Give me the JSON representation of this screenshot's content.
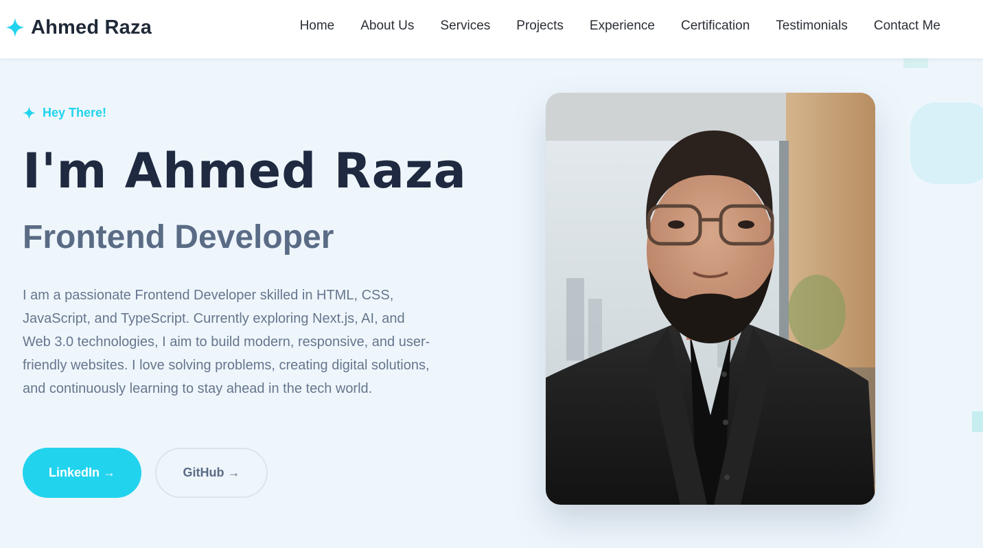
{
  "header": {
    "brand_icon": "sparkle-icon",
    "brand_name": "Ahmed Raza",
    "nav": [
      "Home",
      "About Us",
      "Services",
      "Projects",
      "Experience",
      "Certification",
      "Testimonials",
      "Contact Me"
    ]
  },
  "hero": {
    "eyebrow_icon": "sparkle-icon",
    "eyebrow": "Hey There!",
    "title": "I'm Ahmed Raza",
    "subtitle": "Frontend Developer",
    "description": "I am a passionate Frontend Developer skilled in HTML, CSS, JavaScript, and TypeScript. Currently exploring Next.js, AI, and Web 3.0 technologies, I aim to build modern, responsive, and user-friendly websites. I love solving problems, creating digital solutions, and continuously learning to stay ahead in the tech world.",
    "buttons": {
      "linkedin": "LinkedIn →",
      "github": "GitHub →"
    }
  },
  "colors": {
    "accent": "#22d3ee",
    "title": "#1f2940",
    "subtitle": "#5a6b85",
    "body_text": "#66758d",
    "background": "#eef6fc"
  }
}
